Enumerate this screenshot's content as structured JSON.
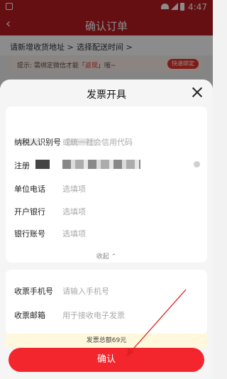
{
  "status": {
    "time": "4:47"
  },
  "appbar": {
    "back_icon": "chevron-left-icon",
    "title": "确认订单"
  },
  "order": {
    "address_label": "请新增收货地址",
    "address_chevron": ">",
    "delivery_label": "选择配送时间",
    "delivery_chevron": ">"
  },
  "tip": {
    "prefix": "提示: 需绑定微信才能「",
    "highlight": "返现",
    "suffix": "」哦~",
    "button": "快速绑定"
  },
  "invoice": {
    "title": "发票开具",
    "fields": [
      {
        "label": "纳税人识别号",
        "placeholder": "或统一社会信用代码"
      },
      {
        "label": "注册",
        "placeholder": ""
      },
      {
        "label": "单位电话",
        "placeholder": "选填项"
      },
      {
        "label": "开户银行",
        "placeholder": "选填项"
      },
      {
        "label": "银行账号",
        "placeholder": "选填项"
      }
    ],
    "collapse_label": "收起",
    "contact_fields": [
      {
        "label": "收票手机号",
        "placeholder": "请输入手机号"
      },
      {
        "label": "收票邮箱",
        "placeholder": "用于接收电子发票"
      }
    ],
    "total_label": "发票总额69元",
    "confirm_label": "确认"
  },
  "colors": {
    "brand": "#b81c22",
    "confirm": "#f3262e",
    "annotation": "#e02020"
  }
}
